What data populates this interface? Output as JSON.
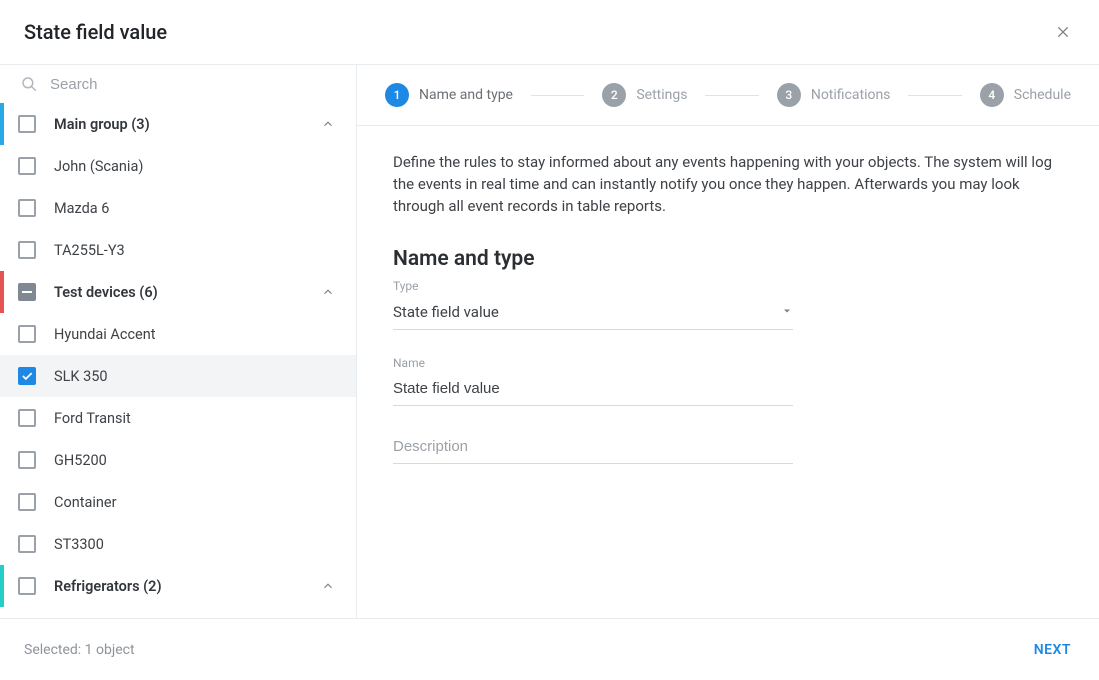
{
  "header": {
    "title": "State field value"
  },
  "search": {
    "placeholder": "Search"
  },
  "sidebar": {
    "groups": [
      {
        "label": "Main group (3)",
        "markerColor": "blue",
        "state": "unchecked",
        "items": [
          {
            "label": "John (Scania)",
            "checked": false
          },
          {
            "label": "Mazda 6",
            "checked": false
          },
          {
            "label": "TA255L-Y3",
            "checked": false
          }
        ]
      },
      {
        "label": "Test devices (6)",
        "markerColor": "red",
        "state": "indeterminate",
        "items": [
          {
            "label": "Hyundai Accent",
            "checked": false
          },
          {
            "label": "SLK 350",
            "checked": true
          },
          {
            "label": "Ford Transit",
            "checked": false
          },
          {
            "label": "GH5200",
            "checked": false
          },
          {
            "label": "Container",
            "checked": false
          },
          {
            "label": "ST3300",
            "checked": false
          }
        ]
      },
      {
        "label": "Refrigerators (2)",
        "markerColor": "teal",
        "state": "unchecked",
        "items": []
      }
    ]
  },
  "stepper": {
    "steps": [
      {
        "num": "1",
        "label": "Name and type",
        "active": true
      },
      {
        "num": "2",
        "label": "Settings",
        "active": false
      },
      {
        "num": "3",
        "label": "Notifications",
        "active": false
      },
      {
        "num": "4",
        "label": "Schedule",
        "active": false
      }
    ]
  },
  "content": {
    "intro": "Define the rules to stay informed about any events happening with your objects. The system will log the events in real time and can instantly notify you once they happen. Afterwards you may look through all event records in table reports.",
    "section_title": "Name and type",
    "type_label": "Type",
    "type_value": "State field value",
    "name_label": "Name",
    "name_value": "State field value",
    "description_placeholder": "Description"
  },
  "footer": {
    "status": "Selected: 1 object",
    "next": "NEXT"
  }
}
